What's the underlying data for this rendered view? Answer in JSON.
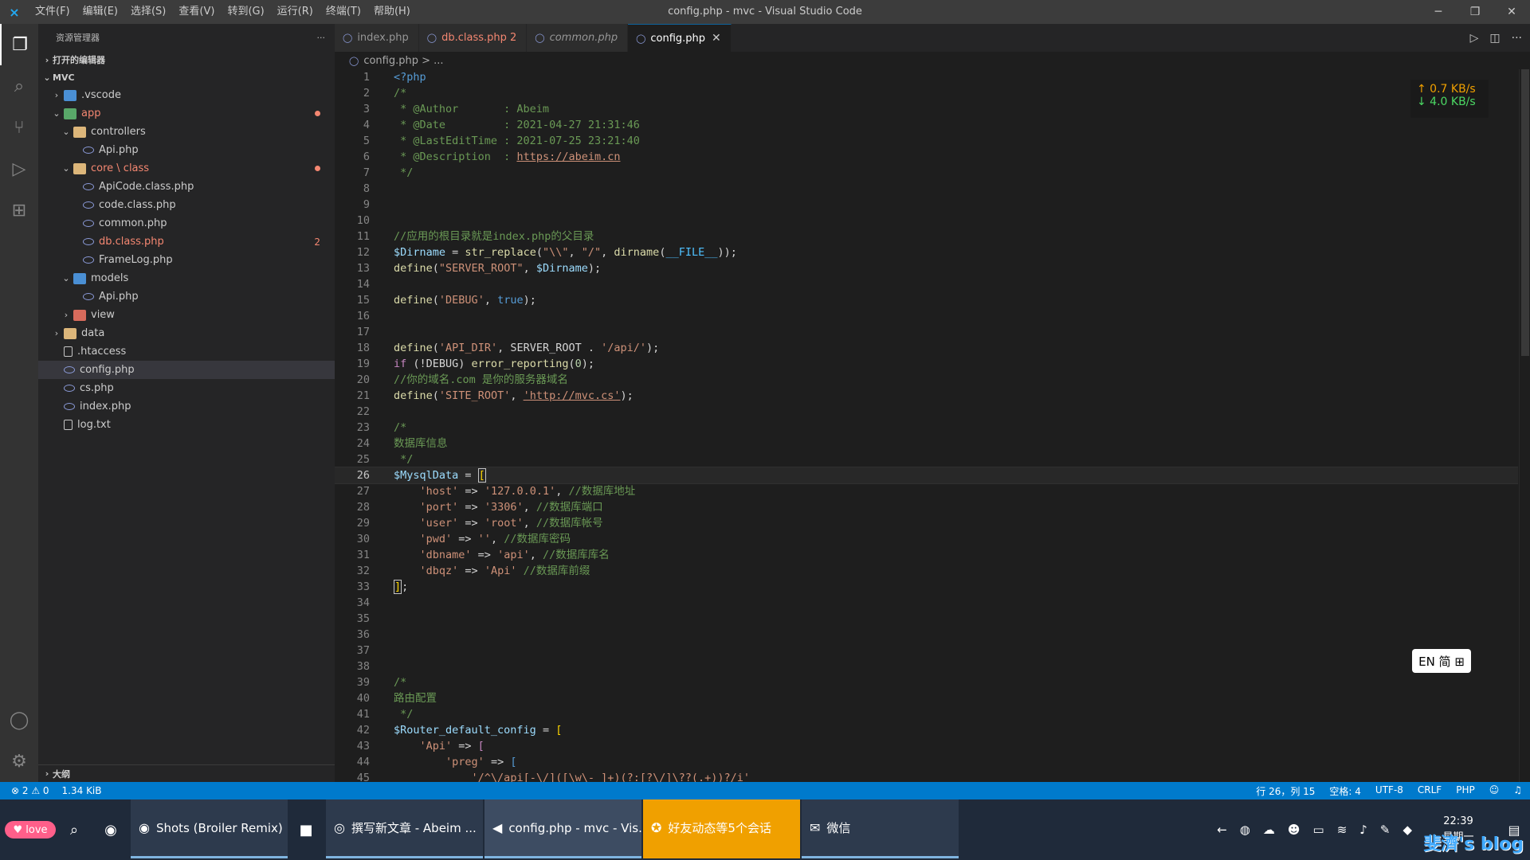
{
  "window": {
    "title": "config.php - mvc - Visual Studio Code",
    "menu": [
      "文件(F)",
      "编辑(E)",
      "选择(S)",
      "查看(V)",
      "转到(G)",
      "运行(R)",
      "终端(T)",
      "帮助(H)"
    ]
  },
  "sidebar": {
    "title": "资源管理器",
    "more": "···",
    "open_editors": "打开的编辑器",
    "root": "MVC",
    "outline": "大纲",
    "tree": [
      {
        "label": ".vscode",
        "depth": 1,
        "type": "folder",
        "color": "blue",
        "expanded": false
      },
      {
        "label": "app",
        "depth": 1,
        "type": "folder",
        "color": "green",
        "expanded": true,
        "error": true,
        "dot": true
      },
      {
        "label": "controllers",
        "depth": 2,
        "type": "folder",
        "color": "yellow",
        "expanded": true
      },
      {
        "label": "Api.php",
        "depth": 3,
        "type": "php"
      },
      {
        "label": "core \\ class",
        "depth": 2,
        "type": "folder",
        "color": "yellow",
        "expanded": true,
        "error": true,
        "dot": true
      },
      {
        "label": "ApiCode.class.php",
        "depth": 3,
        "type": "php"
      },
      {
        "label": "code.class.php",
        "depth": 3,
        "type": "php"
      },
      {
        "label": "common.php",
        "depth": 3,
        "type": "php"
      },
      {
        "label": "db.class.php",
        "depth": 3,
        "type": "php",
        "error": true,
        "count": "2"
      },
      {
        "label": "FrameLog.php",
        "depth": 3,
        "type": "php"
      },
      {
        "label": "models",
        "depth": 2,
        "type": "folder",
        "color": "blue",
        "expanded": true
      },
      {
        "label": "Api.php",
        "depth": 3,
        "type": "php"
      },
      {
        "label": "view",
        "depth": 2,
        "type": "folder",
        "color": "red",
        "expanded": false
      },
      {
        "label": "data",
        "depth": 1,
        "type": "folder",
        "color": "yellow",
        "expanded": false
      },
      {
        "label": ".htaccess",
        "depth": 1,
        "type": "txt"
      },
      {
        "label": "config.php",
        "depth": 1,
        "type": "php",
        "selected": true
      },
      {
        "label": "cs.php",
        "depth": 1,
        "type": "php"
      },
      {
        "label": "index.php",
        "depth": 1,
        "type": "php"
      },
      {
        "label": "log.txt",
        "depth": 1,
        "type": "txt"
      }
    ]
  },
  "tabs": [
    {
      "label": "index.php",
      "state": "normal"
    },
    {
      "label": "db.class.php 2",
      "state": "modified"
    },
    {
      "label": "common.php",
      "state": "italic"
    },
    {
      "label": "config.php",
      "state": "active"
    }
  ],
  "breadcrumb": "config.php > ...",
  "editor": {
    "current_line": 26,
    "lines": [
      [
        {
          "t": "tag",
          "v": "<?php"
        }
      ],
      [
        {
          "t": "cmt",
          "v": "/*"
        }
      ],
      [
        {
          "t": "cmt",
          "v": " * @Author       : Abeim"
        }
      ],
      [
        {
          "t": "cmt",
          "v": " * @Date         : 2021-04-27 21:31:46"
        }
      ],
      [
        {
          "t": "cmt",
          "v": " * @LastEditTime : 2021-07-25 23:21:40"
        }
      ],
      [
        {
          "t": "cmt",
          "v": " * @Description  : "
        },
        {
          "t": "link",
          "v": "https://abeim.cn"
        }
      ],
      [
        {
          "t": "cmt",
          "v": " */"
        }
      ],
      [],
      [],
      [],
      [
        {
          "t": "cmt",
          "v": "//应用的根目录就是index.php的父目录"
        }
      ],
      [
        {
          "t": "var",
          "v": "$Dirname"
        },
        {
          "t": "plain",
          "v": " = "
        },
        {
          "t": "fn",
          "v": "str_replace"
        },
        {
          "t": "plain",
          "v": "("
        },
        {
          "t": "str",
          "v": "\"\\\\\""
        },
        {
          "t": "plain",
          "v": ", "
        },
        {
          "t": "str",
          "v": "\"/\""
        },
        {
          "t": "plain",
          "v": ", "
        },
        {
          "t": "fn",
          "v": "dirname"
        },
        {
          "t": "plain",
          "v": "("
        },
        {
          "t": "const",
          "v": "__FILE__"
        },
        {
          "t": "plain",
          "v": "));"
        }
      ],
      [
        {
          "t": "fn",
          "v": "define"
        },
        {
          "t": "plain",
          "v": "("
        },
        {
          "t": "str",
          "v": "\"SERVER_ROOT\""
        },
        {
          "t": "plain",
          "v": ", "
        },
        {
          "t": "var",
          "v": "$Dirname"
        },
        {
          "t": "plain",
          "v": ");"
        }
      ],
      [],
      [
        {
          "t": "fn",
          "v": "define"
        },
        {
          "t": "plain",
          "v": "("
        },
        {
          "t": "str",
          "v": "'DEBUG'"
        },
        {
          "t": "plain",
          "v": ", "
        },
        {
          "t": "kw",
          "v": "true"
        },
        {
          "t": "plain",
          "v": ");"
        }
      ],
      [],
      [],
      [
        {
          "t": "fn",
          "v": "define"
        },
        {
          "t": "plain",
          "v": "("
        },
        {
          "t": "str",
          "v": "'API_DIR'"
        },
        {
          "t": "plain",
          "v": ", SERVER_ROOT . "
        },
        {
          "t": "str",
          "v": "'/api/'"
        },
        {
          "t": "plain",
          "v": ");"
        }
      ],
      [
        {
          "t": "ctrl",
          "v": "if"
        },
        {
          "t": "plain",
          "v": " (!DEBUG) "
        },
        {
          "t": "fn",
          "v": "error_reporting"
        },
        {
          "t": "plain",
          "v": "("
        },
        {
          "t": "num",
          "v": "0"
        },
        {
          "t": "plain",
          "v": ");"
        }
      ],
      [
        {
          "t": "cmt",
          "v": "//你的域名.com 是你的服务器域名"
        }
      ],
      [
        {
          "t": "fn",
          "v": "define"
        },
        {
          "t": "plain",
          "v": "("
        },
        {
          "t": "str",
          "v": "'SITE_ROOT'"
        },
        {
          "t": "plain",
          "v": ", "
        },
        {
          "t": "link",
          "v": "'http://mvc.cs'"
        },
        {
          "t": "plain",
          "v": ");"
        }
      ],
      [],
      [
        {
          "t": "cmt",
          "v": "/*"
        }
      ],
      [
        {
          "t": "cmt",
          "v": "数据库信息"
        }
      ],
      [
        {
          "t": "cmt",
          "v": " */"
        }
      ],
      [
        {
          "t": "var",
          "v": "$MysqlData"
        },
        {
          "t": "plain",
          "v": " = "
        },
        {
          "t": "cursor",
          "v": "["
        }
      ],
      [
        {
          "t": "plain",
          "v": "    "
        },
        {
          "t": "str",
          "v": "'host'"
        },
        {
          "t": "plain",
          "v": " => "
        },
        {
          "t": "str",
          "v": "'127.0.0.1'"
        },
        {
          "t": "plain",
          "v": ", "
        },
        {
          "t": "cmt",
          "v": "//数据库地址"
        }
      ],
      [
        {
          "t": "plain",
          "v": "    "
        },
        {
          "t": "str",
          "v": "'port'"
        },
        {
          "t": "plain",
          "v": " => "
        },
        {
          "t": "str",
          "v": "'3306'"
        },
        {
          "t": "plain",
          "v": ", "
        },
        {
          "t": "cmt",
          "v": "//数据库端口"
        }
      ],
      [
        {
          "t": "plain",
          "v": "    "
        },
        {
          "t": "str",
          "v": "'user'"
        },
        {
          "t": "plain",
          "v": " => "
        },
        {
          "t": "str",
          "v": "'root'"
        },
        {
          "t": "plain",
          "v": ", "
        },
        {
          "t": "cmt",
          "v": "//数据库帐号"
        }
      ],
      [
        {
          "t": "plain",
          "v": "    "
        },
        {
          "t": "str",
          "v": "'pwd'"
        },
        {
          "t": "plain",
          "v": " => "
        },
        {
          "t": "str",
          "v": "''"
        },
        {
          "t": "plain",
          "v": ", "
        },
        {
          "t": "cmt",
          "v": "//数据库密码"
        }
      ],
      [
        {
          "t": "plain",
          "v": "    "
        },
        {
          "t": "str",
          "v": "'dbname'"
        },
        {
          "t": "plain",
          "v": " => "
        },
        {
          "t": "str",
          "v": "'api'"
        },
        {
          "t": "plain",
          "v": ", "
        },
        {
          "t": "cmt",
          "v": "//数据库库名"
        }
      ],
      [
        {
          "t": "plain",
          "v": "    "
        },
        {
          "t": "str",
          "v": "'dbqz'"
        },
        {
          "t": "plain",
          "v": " => "
        },
        {
          "t": "str",
          "v": "'Api'"
        },
        {
          "t": "plain",
          "v": " "
        },
        {
          "t": "cmt",
          "v": "//数据库前缀"
        }
      ],
      [
        {
          "t": "cursor",
          "v": "]"
        },
        {
          "t": "plain",
          "v": ";"
        }
      ],
      [],
      [],
      [],
      [],
      [],
      [
        {
          "t": "cmt",
          "v": "/*"
        }
      ],
      [
        {
          "t": "cmt",
          "v": "路由配置"
        }
      ],
      [
        {
          "t": "cmt",
          "v": " */"
        }
      ],
      [
        {
          "t": "var",
          "v": "$Router_default_config"
        },
        {
          "t": "plain",
          "v": " = "
        },
        {
          "t": "br",
          "v": "["
        }
      ],
      [
        {
          "t": "plain",
          "v": "    "
        },
        {
          "t": "str",
          "v": "'Api'"
        },
        {
          "t": "plain",
          "v": " => "
        },
        {
          "t": "ctrl",
          "v": "["
        }
      ],
      [
        {
          "t": "plain",
          "v": "        "
        },
        {
          "t": "str",
          "v": "'preg'"
        },
        {
          "t": "plain",
          "v": " => "
        },
        {
          "t": "kw",
          "v": "["
        }
      ],
      [
        {
          "t": "plain",
          "v": "            "
        },
        {
          "t": "str",
          "v": "'/^\\/api[-\\/]([\\w\\-_]+)(?:[?\\/]\\??(.+))?/i'"
        }
      ]
    ]
  },
  "net_widget": {
    "up": "↑ 0.7 KB/s",
    "down": "↓ 4.0 KB/s"
  },
  "ime": "EN 简 ⊞",
  "statusbar": {
    "problems": "⊗ 2 ⚠ 0",
    "size": "1.34 KiB",
    "position": "行 26，列 15",
    "indent": "空格: 4",
    "encoding": "UTF-8",
    "eol": "CRLF",
    "language": "PHP"
  },
  "taskbar": {
    "love": "♥ love",
    "apps": [
      {
        "label": "Shots (Broiler Remix) ...",
        "icon": "◉",
        "state": "normal"
      },
      {
        "label": "撰写新文章 - Abeim ...",
        "icon": "◎",
        "state": "normal"
      },
      {
        "label": "config.php - mvc - Vis...",
        "icon": "◀",
        "state": "active"
      },
      {
        "label": "好友动态等5个会话",
        "icon": "✪",
        "state": "flash"
      },
      {
        "label": "微信",
        "icon": "✉",
        "state": "normal"
      }
    ],
    "time": "22:39",
    "day": "星期一",
    "blog": "斐濟's blog"
  },
  "colors": {
    "accent": "#007acc",
    "error": "#f48771"
  }
}
